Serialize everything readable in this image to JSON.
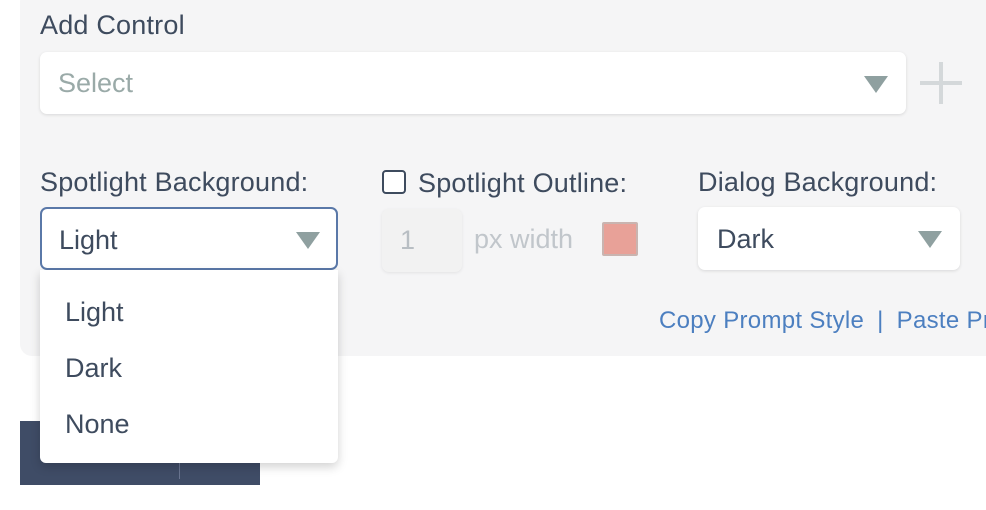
{
  "add_control": {
    "label": "Add Control",
    "select_placeholder": "Select"
  },
  "spotlight_background": {
    "label": "Spotlight Background:",
    "selected": "Light",
    "options": [
      "Light",
      "Dark",
      "None"
    ]
  },
  "spotlight_outline": {
    "label": "Spotlight Outline:",
    "checked": false,
    "width_value": "1",
    "unit_label": "px width",
    "color": "#e8a198"
  },
  "dialog_background": {
    "label": "Dialog Background:",
    "selected": "Dark"
  },
  "links": {
    "copy": "Copy Prompt Style",
    "separator": "|",
    "paste": "Paste Pr"
  },
  "icons": {
    "add": "plus-icon",
    "dropdown": "chevron-down-icon"
  },
  "colors": {
    "accent_link": "#4c7fc0",
    "focus_border": "#5a78a8",
    "actions_bar": "#3f4c66"
  }
}
